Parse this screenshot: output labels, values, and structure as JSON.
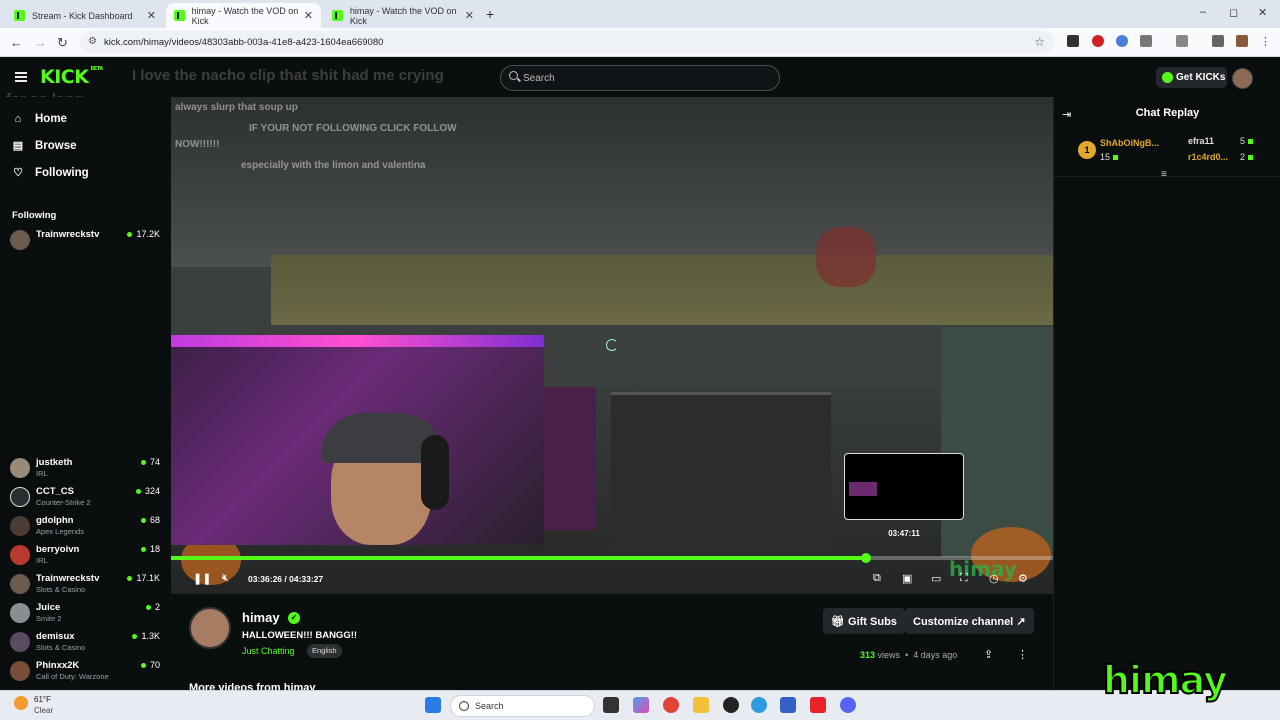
{
  "browser": {
    "tabs": [
      {
        "title": "Stream - Kick Dashboard",
        "active": false
      },
      {
        "title": "himay - Watch the VOD on Kick",
        "active": true
      },
      {
        "title": "himay - Watch the VOD on Kick",
        "active": false
      }
    ],
    "new_tab": "+",
    "url": "kick.com/himay/videos/48303abb-003a-41e8-a423-1604ea669080",
    "window_controls": [
      "–",
      "◻",
      "✕"
    ]
  },
  "topbar": {
    "logo": "KICK",
    "logo_badge": "BETA",
    "search_placeholder": "Search",
    "get_kicks": "Get KICKs"
  },
  "sidebar": {
    "nav": [
      {
        "label": "Home",
        "icon": "home-icon"
      },
      {
        "label": "Browse",
        "icon": "browse-icon"
      },
      {
        "label": "Following",
        "icon": "heart-icon"
      }
    ],
    "following_heading": "Following",
    "following": [
      {
        "name": "Trainwreckstv",
        "category": "",
        "viewers": "17.2K",
        "color": "#6b5a4e"
      },
      {
        "name": "justketh",
        "category": "IRL",
        "viewers": "74",
        "color": "#9a8a7a"
      },
      {
        "name": "CCT_CS",
        "category": "Counter-Strike 2",
        "viewers": "324",
        "color": "#2b2e31"
      },
      {
        "name": "gdolphn",
        "category": "Apex Legends",
        "viewers": "68",
        "color": "#4c3c32"
      },
      {
        "name": "berryoivn",
        "category": "IRL",
        "viewers": "18",
        "color": "#b9382f"
      },
      {
        "name": "Trainwreckstv",
        "category": "Slots & Casino",
        "viewers": "17.1K",
        "color": "#6b5a4e"
      },
      {
        "name": "Juice",
        "category": "Smite 2",
        "viewers": "2",
        "color": "#8a8e93"
      },
      {
        "name": "demisux",
        "category": "Slots & Casino",
        "viewers": "1.3K",
        "color": "#5a4b63"
      },
      {
        "name": "Phinxx2K",
        "category": "Call of Duty: Warzone",
        "viewers": "70",
        "color": "#7a4c3a"
      }
    ]
  },
  "video": {
    "overlay_chat_top": "I love the nacho clip that shit had me crying",
    "overlay_chat_top2": "for so long",
    "overlay_chat": [
      "always slurp that soup up",
      "IF YOUR NOT FOLLOWING CLICK FOLLOW",
      "NOW!!!!!!",
      "especially with the limon and valentina"
    ],
    "hover_time": "03:47:11",
    "current_time": "03:36:26",
    "total_time": "04:33:27",
    "progress": 0.788,
    "watermark": "himay"
  },
  "stream": {
    "name": "himay",
    "title": "HALLOWEEN!!!  BANGG!!",
    "category": "Just Chatting",
    "language": "English",
    "gift_subs": "Gift Subs",
    "customize": "Customize channel",
    "views_count": "313",
    "views_label": "views",
    "age": "4 days ago",
    "more_videos": "More videos from himay"
  },
  "chat": {
    "title": "Chat Replay",
    "leaderboard": [
      {
        "rank": "1",
        "name": "ShAbOiNgB...",
        "count": "15"
      },
      {
        "name": "efra11",
        "count": "5"
      },
      {
        "name": "r1c4rd0...",
        "count": "2"
      }
    ]
  },
  "taskbar": {
    "temp": "61°F",
    "condition": "Clear",
    "search": "Search",
    "corner_watermark": "himay"
  }
}
